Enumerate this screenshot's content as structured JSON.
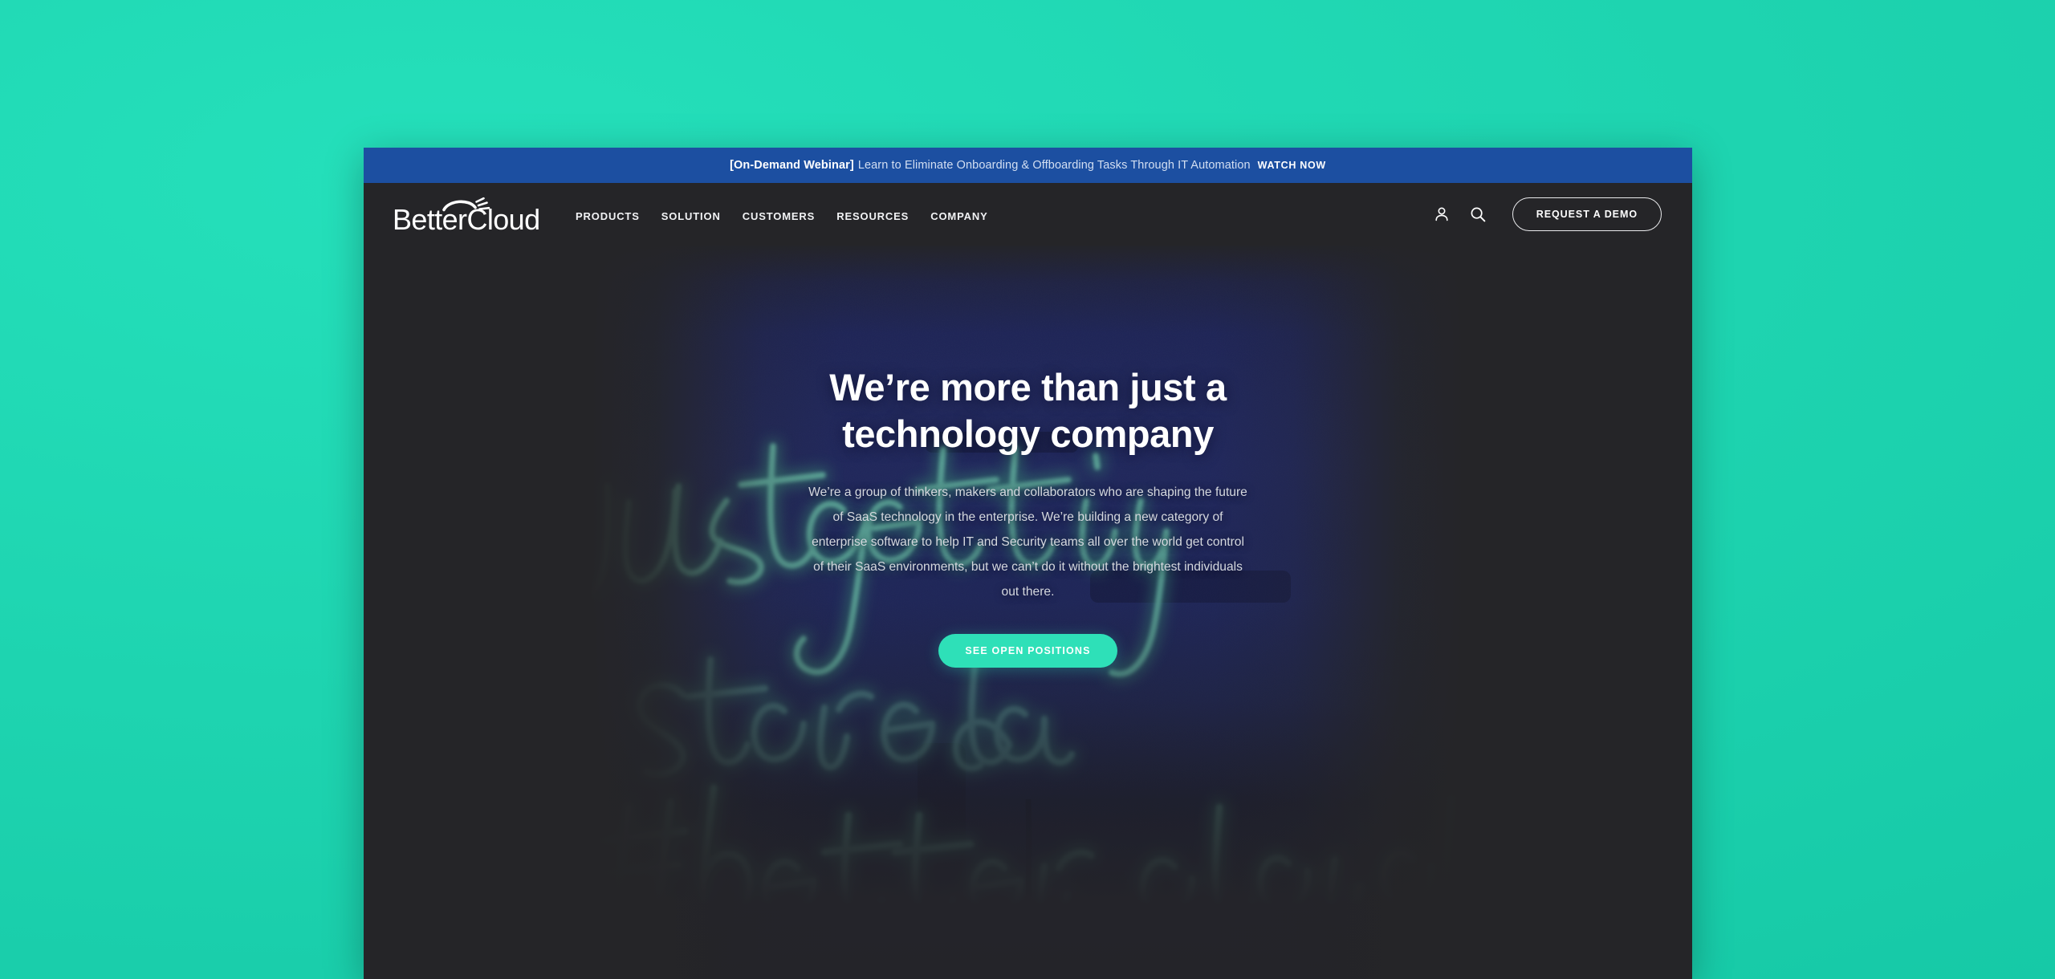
{
  "desktop": {
    "background_color": "#1fd8b4"
  },
  "window": {
    "background_color": "#252528"
  },
  "banner": {
    "tag": "[On-Demand Webinar]",
    "message": "Learn to Eliminate Onboarding & Offboarding Tasks Through IT Automation",
    "cta_label": "WATCH NOW",
    "background_color": "#1c4fa1"
  },
  "header": {
    "logo_text": "BetterCloud",
    "nav_items": [
      {
        "label": "PRODUCTS"
      },
      {
        "label": "SOLUTION"
      },
      {
        "label": "CUSTOMERS"
      },
      {
        "label": "RESOURCES"
      },
      {
        "label": "COMPANY"
      }
    ],
    "account_icon": "person-icon",
    "search_icon": "search-icon",
    "demo_button_label": "REQUEST A DEMO"
  },
  "hero": {
    "title": "We’re more than just a technology company",
    "paragraph": "We’re a group of thinkers, makers and collaborators who are shaping the future of SaaS technology in the enterprise. We’re building a new category of enterprise software to help IT and Security teams all over the world get control of their SaaS environments, but we can’t do it without the brightest individuals out there.",
    "cta_label": "SEE OPEN POSITIONS",
    "cta_color": "#2ee0b8",
    "background_art": {
      "description": "neon sign photograph on deep blue wall",
      "line_1": "just getting",
      "line_2": "started",
      "line_3": "#bettercloud",
      "neon_color": "#54c9ab",
      "wall_color": "#232a63"
    }
  }
}
